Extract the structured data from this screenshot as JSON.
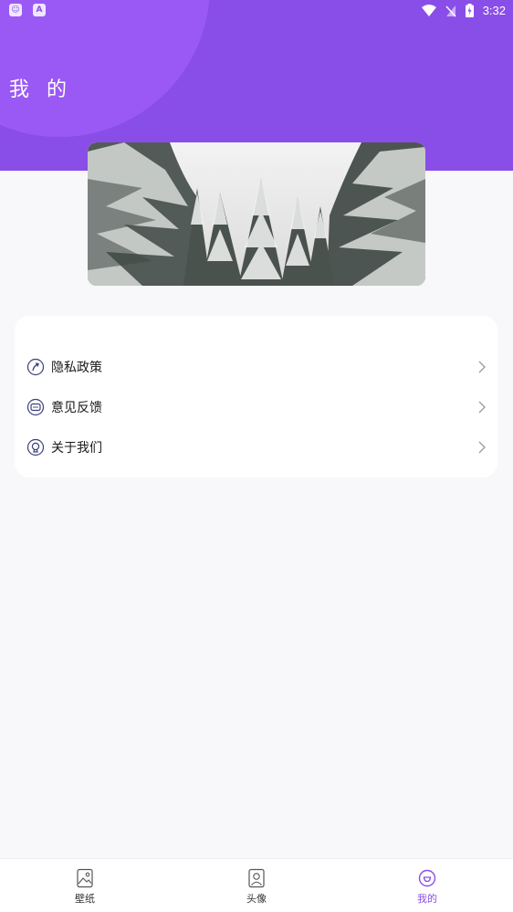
{
  "status_bar": {
    "time": "3:32"
  },
  "header": {
    "title": "我 的"
  },
  "banner": {
    "image_desc": "snow-covered-pine-trees"
  },
  "menu": {
    "items": [
      {
        "label": "隐私政策",
        "icon": "privacy-icon"
      },
      {
        "label": "意见反馈",
        "icon": "feedback-icon"
      },
      {
        "label": "关于我们",
        "icon": "about-icon"
      }
    ]
  },
  "bottom_nav": {
    "items": [
      {
        "label": "壁纸",
        "icon": "wallpaper-icon"
      },
      {
        "label": "头像",
        "icon": "avatar-icon"
      },
      {
        "label": "我的",
        "icon": "profile-icon",
        "active": true
      }
    ]
  },
  "colors": {
    "brand": "#8a4ee8",
    "brand_light": "#9a59f5",
    "background": "#f8f7f9"
  }
}
